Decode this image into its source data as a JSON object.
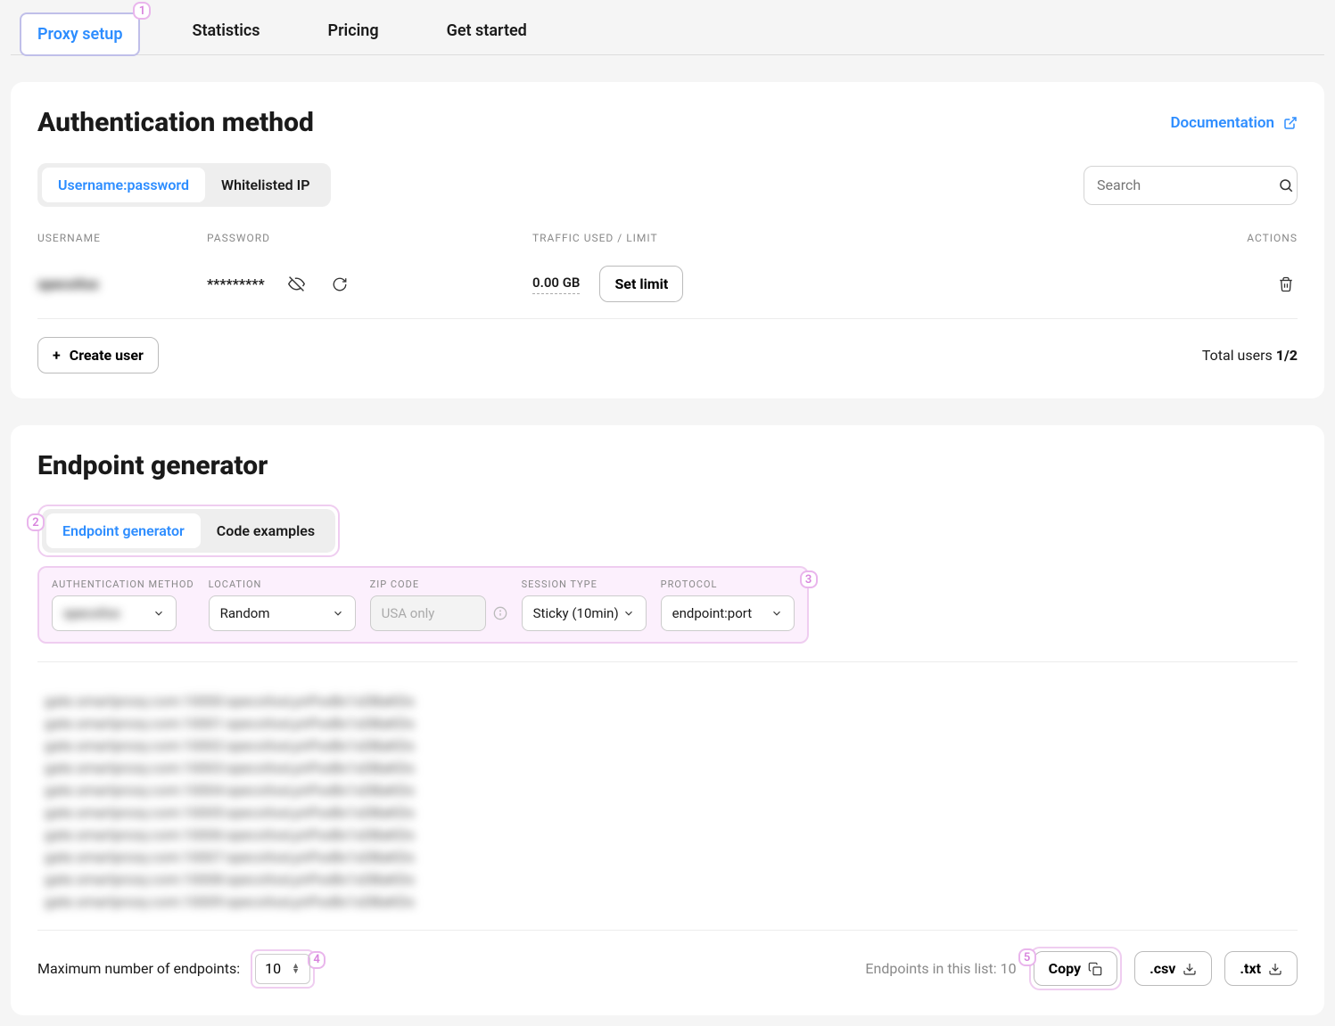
{
  "tabs": {
    "proxy_setup": "Proxy setup",
    "statistics": "Statistics",
    "pricing": "Pricing",
    "get_started": "Get started"
  },
  "markers": {
    "m1": "1",
    "m2": "2",
    "m3": "3",
    "m4": "4",
    "m5": "5"
  },
  "auth_panel": {
    "title": "Authentication method",
    "doc": "Documentation",
    "toggles": {
      "userpass": "Username:password",
      "whitelist": "Whitelisted IP"
    },
    "search_placeholder": "Search",
    "columns": {
      "username": "USERNAME",
      "password": "PASSWORD",
      "traffic": "TRAFFIC USED / LIMIT",
      "actions": "ACTIONS"
    },
    "row": {
      "username": "specxXxx",
      "password": "*********",
      "traffic": "0.00 GB",
      "set_limit": "Set limit"
    },
    "create_user": "Create user",
    "total_label": "Total users ",
    "total_value": "1/2"
  },
  "endpoint_panel": {
    "title": "Endpoint generator",
    "toggles": {
      "generator": "Endpoint generator",
      "code": "Code examples"
    },
    "fields": {
      "auth_label": "AUTHENTICATION METHOD",
      "auth_value": "specxXxx",
      "loc_label": "LOCATION",
      "loc_value": "Random",
      "zip_label": "ZIP CODE",
      "zip_placeholder": "USA only",
      "sess_label": "SESSION TYPE",
      "sess_value": "Sticky (10min)",
      "proto_label": "PROTOCOL",
      "proto_value": "endpoint:port"
    },
    "endpoints": [
      "gate.smartproxy.com:10000:specxXxxLynPxxBx1xDBaKDs",
      "gate.smartproxy.com:10001:specxXxxLynPxxBx1xDBaKDs",
      "gate.smartproxy.com:10002:specxXxxLynPxxBx1xDBaKDs",
      "gate.smartproxy.com:10003:specxXxxLynPxxBx1xDBaKDs",
      "gate.smartproxy.com:10004:specxXxxLynPxxBx1xDBaKDs",
      "gate.smartproxy.com:10005:specxXxxLynPxxBx1xDBaKDs",
      "gate.smartproxy.com:10006:specxXxxLynPxxBx1xDBaKDs",
      "gate.smartproxy.com:10007:specxXxxLynPxxBx1xDBaKDs",
      "gate.smartproxy.com:10008:specxXxxLynPxxBx1xDBaKDs",
      "gate.smartproxy.com:10009:specxXxxLynPxxBx1xDBaKDs"
    ],
    "max_label": "Maximum number of endpoints:",
    "max_value": "10",
    "list_count_label": "Endpoints in this list: ",
    "list_count_value": "10",
    "copy": "Copy",
    "csv": ".csv",
    "txt": ".txt"
  }
}
